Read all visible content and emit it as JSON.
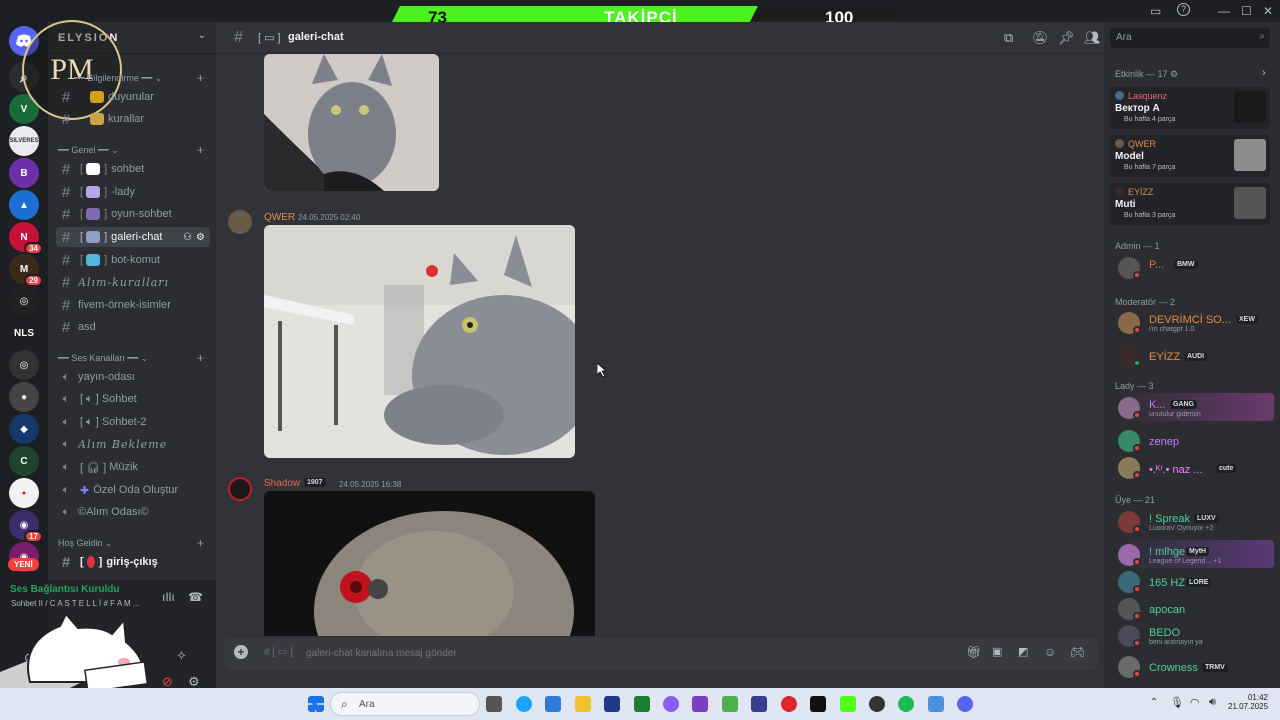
{
  "overlay": {
    "follower_label": "TAKİPÇİ",
    "follower_current": "73",
    "follower_goal": "100"
  },
  "server": {
    "name": "ELYSION",
    "logo_text": "PM"
  },
  "sidebar": {
    "categories": [
      {
        "label": "━━ Bilgilendirme ━━"
      },
      {
        "label": "━━ Genel ━━"
      },
      {
        "label": "━━ Ses Kanalları ━━"
      },
      {
        "label": "Hoş Geldin"
      }
    ],
    "text_channels": [
      {
        "label": "duyurular"
      },
      {
        "label": "kurallar"
      },
      {
        "label": "sohbet"
      },
      {
        "label": "-lady"
      },
      {
        "label": "oyun-sohbet"
      },
      {
        "label": "galeri-chat"
      },
      {
        "label": "bot-komut"
      },
      {
        "label": "Alım-kuralları"
      },
      {
        "label": "fivem-örnek-isimler"
      },
      {
        "label": "asd"
      }
    ],
    "voice_channels": [
      {
        "label": "yayın-odası"
      },
      {
        "label": "Sohbet"
      },
      {
        "label": "Sohbet-2"
      },
      {
        "label": "Alım Bekleme"
      },
      {
        "label": "Müzik"
      },
      {
        "label": "Özel Oda Oluştur"
      },
      {
        "label": "©Alım Odası©"
      }
    ],
    "welcome_channel": "giriş-çıkış",
    "new_badge": "YENİ",
    "voice_status": "Ses Bağlantısı Kuruldu",
    "voice_location": "Sohbet II / C A S T E L L İ # F A M ..."
  },
  "rail": {
    "servers": [
      {
        "label": "SILVERES"
      },
      {
        "label": "NLS"
      }
    ],
    "badges": [
      "34",
      "29",
      "17"
    ]
  },
  "main": {
    "channel_name": "galeri-chat",
    "messages": [
      {
        "author": "QWER",
        "time": "24.05.2025 02:40"
      },
      {
        "author": "Shadow",
        "tag": "1907",
        "time": "24.05.2025 16:38"
      }
    ],
    "composer_placeholder": "galeri-chat kanalına mesaj gönder"
  },
  "members": {
    "search_placeholder": "Ara",
    "activity_header": "Etkinlik — 17",
    "activities": [
      {
        "user": "Lasquenz",
        "title": "Вектор А",
        "sub": "Bu hafta 4 parça",
        "color": "#e06c75"
      },
      {
        "user": "QWER",
        "title": "Model",
        "sub": "Bu hafta 7 parça",
        "color": "#e28c4a"
      },
      {
        "user": "EYİZZ",
        "title": "Muti",
        "sub": "Bu hafta 3 parça",
        "color": "#e28c4a"
      }
    ],
    "groups": [
      {
        "label": "Admin — 1"
      },
      {
        "label": "Moderatör — 2"
      },
      {
        "label": "Lady — 3"
      },
      {
        "label": "Üye — 21"
      }
    ],
    "admin": [
      {
        "name": "P...",
        "tag": "BMW"
      }
    ],
    "mods": [
      {
        "name": "DEVRİMCİ SO...",
        "tag": "XEW",
        "status": "i'm chatgpt 1.0"
      },
      {
        "name": "EYİZZ",
        "tag": "AUDI"
      }
    ],
    "lady": [
      {
        "name": "K...",
        "tag": "GANG",
        "status": "unutulur gidersin"
      },
      {
        "name": "zenep"
      },
      {
        "name": "•.ᴷⁱ.• naz ...",
        "tag": "cute"
      }
    ],
    "uye": [
      {
        "name": "! Spreak",
        "tag": "LUXV",
        "status": "LuxoraV Oynuyor +2"
      },
      {
        "name": "! mlhge",
        "tag": "MytH",
        "status": "League of Legend... +1"
      },
      {
        "name": "165 HZ",
        "tag": "LORE"
      },
      {
        "name": "apocan"
      },
      {
        "name": "BEDO",
        "status": "beni aramayın ya"
      },
      {
        "name": "Crowness",
        "tag": "TRMV"
      }
    ]
  },
  "taskbar": {
    "search_placeholder": "Ara",
    "time": "01:42",
    "date": "21.07.2025"
  }
}
